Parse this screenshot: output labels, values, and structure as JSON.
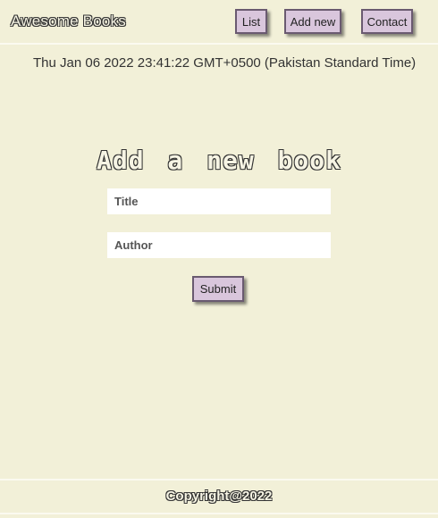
{
  "header": {
    "logo": "Awesome Books",
    "nav": {
      "list_label": "List",
      "add_new_label": "Add new",
      "contact_label": "Contact"
    }
  },
  "datetime": "Thu Jan 06 2022 23:41:22 GMT+0500 (Pakistan Standard Time)",
  "form": {
    "title": "Add a new book",
    "title_placeholder": "Title",
    "author_placeholder": "Author",
    "submit_label": "Submit"
  },
  "footer": {
    "copyright": "Copyright@2022"
  },
  "colors": {
    "background": "#f2f0d8",
    "button": "#d9c6dc",
    "input": "#ffffff"
  }
}
